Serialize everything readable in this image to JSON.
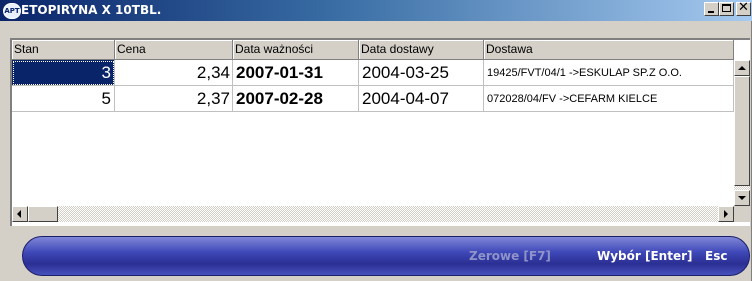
{
  "window": {
    "app_icon_text": "APT",
    "title": "ETOPIRYNA X 10TBL.",
    "buttons": {
      "minimize": "minimize",
      "maximize": "maximize",
      "close": "✕"
    }
  },
  "table": {
    "columns": [
      "Stan",
      "Cena",
      "Data ważności",
      "Data dostawy",
      "Dostawa"
    ],
    "rows": [
      {
        "stan": "3",
        "cena": "2,34",
        "data_waznosci": "2007-01-31",
        "data_dostawy": "2004-03-25",
        "dostawa": "19425/FVT/04/1 ->ESKULAP SP.Z O.O."
      },
      {
        "stan": "5",
        "cena": "2,37",
        "data_waznosci": "2007-02-28",
        "data_dostawy": "2004-04-07",
        "dostawa": "072028/04/FV ->CEFARM KIELCE"
      }
    ],
    "selected_row": 0
  },
  "actions": {
    "zerowe": "Zerowe [F7]",
    "wybor": "Wybór [Enter]",
    "esc": "Esc"
  },
  "colors": {
    "title_bar_start": "#0a246a",
    "selection": "#0a246a",
    "pill": "#3f48b8",
    "disabled_text": "#8f94c8"
  }
}
